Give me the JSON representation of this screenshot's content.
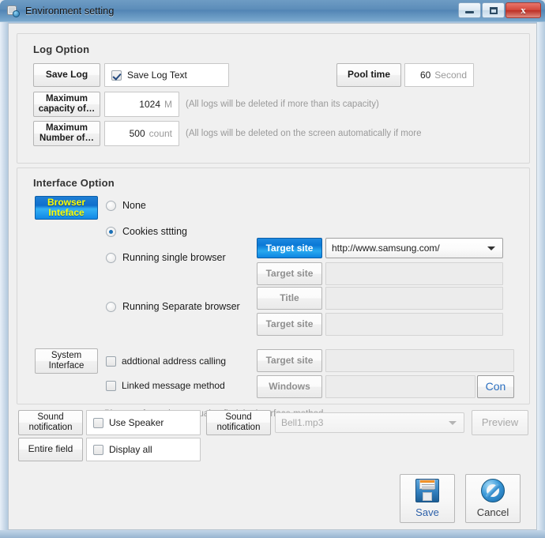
{
  "window": {
    "title": "Environment setting",
    "icon": "settings-gear-icon",
    "buttons": {
      "minimize": "Minimize",
      "maximize": "Maximize",
      "close": "Close"
    }
  },
  "log_option": {
    "title": "Log Option",
    "save_log_button": "Save Log",
    "save_log_text_checkbox": {
      "label": "Save Log Text",
      "checked": true
    },
    "pool_time_button": "Pool time",
    "pool_time_value": "60",
    "pool_time_unit": "Second",
    "max_capacity_button_line1": "Maximum",
    "max_capacity_button_line2": "capacity of…",
    "max_capacity_value": "1024",
    "max_capacity_unit": "M",
    "max_capacity_note": "(All logs will be deleted if more than its capacity)",
    "max_number_button_line1": "Maximum",
    "max_number_button_line2": "Number of…",
    "max_number_value": "500",
    "max_number_unit": "count",
    "max_number_note": "(All logs will be deleted on the screen automatically if more"
  },
  "interface_option": {
    "title": "Interface Option",
    "browser_interface_button_line1": "Browser",
    "browser_interface_button_line2": "Inteface",
    "system_interface_button_line1": "System",
    "system_interface_button_line2": "Interface",
    "radios": [
      {
        "label": "None",
        "selected": false
      },
      {
        "label": "Cookies sttting",
        "selected": true
      },
      {
        "label": "Running single browser",
        "selected": false
      },
      {
        "label": "Running Separate browser",
        "selected": false
      }
    ],
    "target_site_button_active": "Target site",
    "target_site_combo_value": "http://www.samsung.com/",
    "target_site_button_2": "Target site",
    "target_site_field_2": "",
    "title_button": "Title",
    "title_field": "",
    "target_site_button_3": "Target site",
    "target_site_field_3": "",
    "additional_address_checkbox": {
      "label": "addtional address calling",
      "checked": false
    },
    "linked_message_checkbox": {
      "label": "Linked message method",
      "checked": false
    },
    "target_site_button_4": "Target site",
    "target_site_field_4": "",
    "windows_button": "Windows",
    "windows_field": "",
    "con_button": "Con",
    "manual_hint": "Please refer to the manual to find the interface method"
  },
  "sound_section": {
    "sound_notification_button_left_line1": "Sound",
    "sound_notification_button_left_line2": "notification",
    "use_speaker_checkbox": {
      "label": "Use Speaker",
      "checked": false
    },
    "entire_field_button": "Entire field",
    "display_all_checkbox": {
      "label": "Display all",
      "checked": false
    },
    "sound_notification_button_right_line1": "Sound",
    "sound_notification_button_right_line2": "notification",
    "sound_file_combo_value": "Bell1.mp3",
    "preview_button": "Preview"
  },
  "footer": {
    "save_button": "Save",
    "save_icon": "floppy-disk-icon",
    "cancel_button": "Cancel",
    "cancel_icon": "no-entry-icon"
  },
  "colors": {
    "accent_blue": "#0b78d6",
    "highlight_yellow": "#ffff00",
    "title_bar": "#5b8cb8",
    "close_red": "#d4483c",
    "link_blue": "#2b5fa8"
  }
}
